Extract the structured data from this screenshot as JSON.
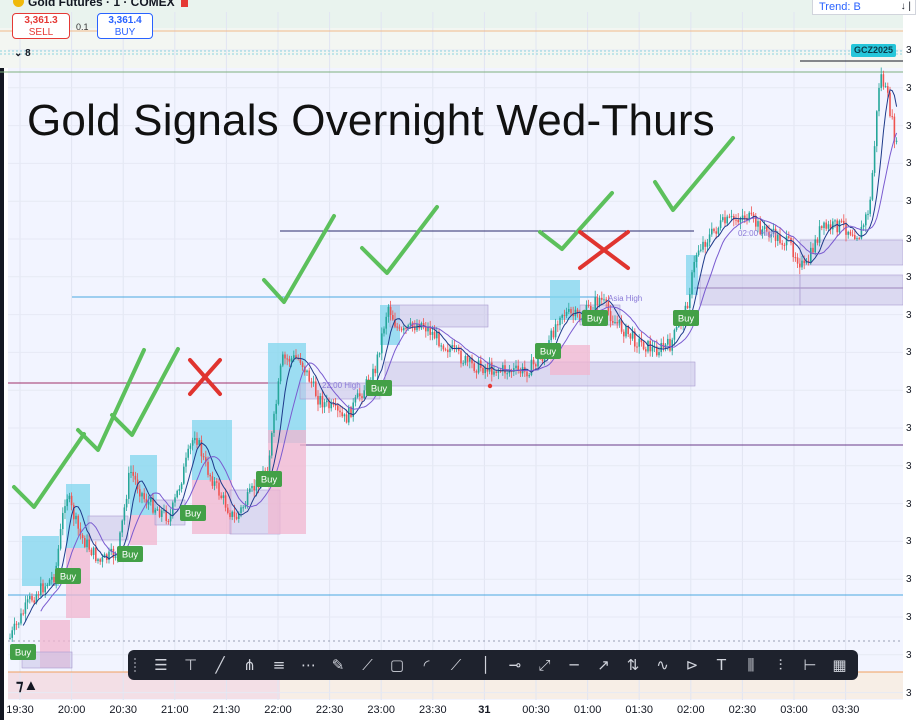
{
  "header": {
    "title": "Gold Futures · 1 · COMEX",
    "sell_price": "3,361.3",
    "sell_label": "SELL",
    "spread": "0.1",
    "buy_price": "3,361.4",
    "buy_label": "BUY",
    "collapsed_count": "8",
    "trend_label": "Trend: B"
  },
  "overlay_title": "Gold Signals Overnight Wed-Thurs",
  "symbol_tag": "GCZ2025",
  "x_axis": {
    "ticks": [
      "19:30",
      "20:00",
      "20:30",
      "21:00",
      "21:30",
      "22:00",
      "22:30",
      "23:00",
      "23:30",
      "31",
      "00:30",
      "01:00",
      "01:30",
      "02:00",
      "02:30",
      "03:00",
      "03:30"
    ]
  },
  "y_axis": {
    "ticks": [
      "3",
      "3",
      "3",
      "3",
      "3",
      "3",
      "3",
      "3",
      "3",
      "3",
      "3",
      "3",
      "3",
      "3",
      "3",
      "3",
      "3",
      "3"
    ]
  },
  "chart_labels": {
    "session_high_1": "22:00 High",
    "asia_high": "Asia High",
    "session_high_2": "02:00 High"
  },
  "colors": {
    "bull": "#26a69a",
    "bear": "#ef5350",
    "buy_signal": "#43a047",
    "check": "#5cc05c",
    "cross": "#e0342f",
    "toolbar_bg": "#1e222d",
    "long_zone": "#7fd6ee",
    "short_zone": "#f2b6cf",
    "range_box": "#c9c2e6"
  },
  "toolbar": {
    "icons": [
      "horizontal-lines-icon",
      "cross-line-icon",
      "trend-line-icon",
      "pitchfork-icon",
      "parallel-channel-icon",
      "regression-channel-icon",
      "brush-icon",
      "path-icon",
      "rectangle-icon",
      "arc-icon",
      "ray-icon",
      "vertical-line-icon",
      "horizontal-ray-icon",
      "extended-line-icon",
      "horizontal-line-icon",
      "arrow-icon",
      "long-position-icon",
      "elliott-wave-icon",
      "xabcd-pattern-icon",
      "text-icon",
      "bars-pattern-icon",
      "projection-icon",
      "date-range-icon",
      "grid-icon"
    ]
  },
  "chart_data": {
    "type": "candlestick",
    "title": "",
    "x_axis_labels": [
      "19:30",
      "20:00",
      "20:30",
      "21:00",
      "21:30",
      "22:00",
      "22:30",
      "23:00",
      "23:30",
      "31",
      "00:30",
      "01:00",
      "01:30",
      "02:00",
      "02:30",
      "03:00",
      "03:30"
    ],
    "price_labels_visible": "truncated (only leading digit \"3\" visible)",
    "price_shown_in_header": 3361.3,
    "candles": "approximately 880 one-minute candles, values not readable (price axis truncated)",
    "indicators": [
      "moving averages (2 lines)",
      "session high/low reference lines"
    ],
    "buy_signals": [
      {
        "time_label": "19:30",
        "label": "Buy",
        "outcome": "check"
      },
      {
        "time_label": "20:00",
        "label": "Buy",
        "outcome": "check"
      },
      {
        "time_label": "20:30",
        "label": "Buy",
        "outcome": "check"
      },
      {
        "time_label": "21:00",
        "label": "Buy",
        "outcome": "cross"
      },
      {
        "time_label": "22:00",
        "label": "Buy",
        "outcome": "check"
      },
      {
        "time_label": "23:00",
        "label": "Buy",
        "outcome": "check"
      },
      {
        "time_label": "00:30",
        "label": "Buy",
        "outcome": "check"
      },
      {
        "time_label": "01:00",
        "label": "Buy",
        "outcome": "cross"
      },
      {
        "time_label": "02:00",
        "label": "Buy",
        "outcome": "check"
      }
    ],
    "annotations": [
      "22:00 High",
      "Asia High",
      "02:00 High"
    ],
    "grid": true,
    "legend": "none"
  }
}
